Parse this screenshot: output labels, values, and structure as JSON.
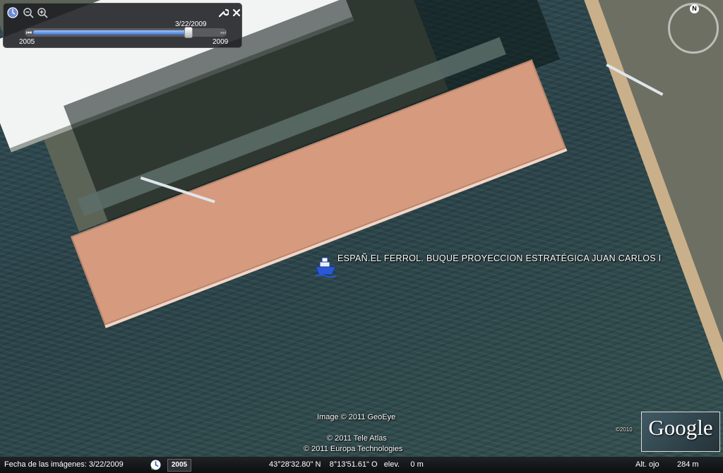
{
  "time_slider": {
    "current_date": "3/22/2009",
    "start_year": "2005",
    "end_year": "2009",
    "position_fraction": 0.88,
    "icons": [
      "clock-icon",
      "zoom-out-icon",
      "zoom-in-icon",
      "wrench-icon",
      "close-icon"
    ],
    "prev_glyph": "⏮",
    "next_glyph": "⏭"
  },
  "compass": {
    "north_label": "N"
  },
  "placemark": {
    "label": "ESPAÑ.EL FERROL. BUQUE PROYECCION ESTRATÉGICA JUAN CARLOS I",
    "icon": "ship-icon",
    "icon_color": "#2a59d6"
  },
  "attribution": {
    "imagery": "Image © 2011 GeoEye",
    "tele_atlas": "© 2011 Tele Atlas",
    "europa": "© 2011 Europa Technologies",
    "year_mark": "©2010",
    "logo": "Google"
  },
  "status_bar": {
    "imagery_date": "Fecha de las imágenes: 3/22/2009",
    "year_button": "2005",
    "coordinates": "43°28'32.80\" N    8°13'51.61\" O   elev.     0 m",
    "eye_alt_label": "Alt. ojo",
    "eye_alt_value": "284 m"
  },
  "colors": {
    "deck": "#d69a7e",
    "water": "#2f4a52",
    "slider_fill": "#3b78d8"
  }
}
